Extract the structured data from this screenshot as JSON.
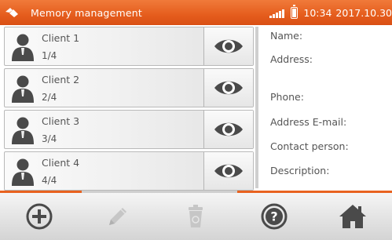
{
  "header": {
    "title": "Memory management",
    "time": "10:34",
    "date": "2017.10.30",
    "logo_icon": "logo-icon",
    "signal_icon": "signal-icon",
    "battery_icon": "battery-icon"
  },
  "clients": [
    {
      "name": "Client 1",
      "count": "1/4"
    },
    {
      "name": "Client 2",
      "count": "2/4"
    },
    {
      "name": "Client 3",
      "count": "3/4"
    },
    {
      "name": "Client 4",
      "count": "4/4"
    }
  ],
  "details": {
    "name_label": "Name:",
    "address_label": "Address:",
    "phone_label": "Phone:",
    "email_label": "Address E-mail:",
    "contact_label": "Contact person:",
    "description_label": "Description:"
  },
  "toolbar": {
    "add_icon": "plus-circle-icon",
    "edit_icon": "pencil-icon",
    "delete_icon": "trash-icon",
    "help_icon": "help-icon",
    "home_icon": "home-icon"
  },
  "colors": {
    "accent": "#e55d1d",
    "text": "#555555",
    "icon": "#4a4a4a",
    "disabled_icon": "#c0c0c0"
  }
}
